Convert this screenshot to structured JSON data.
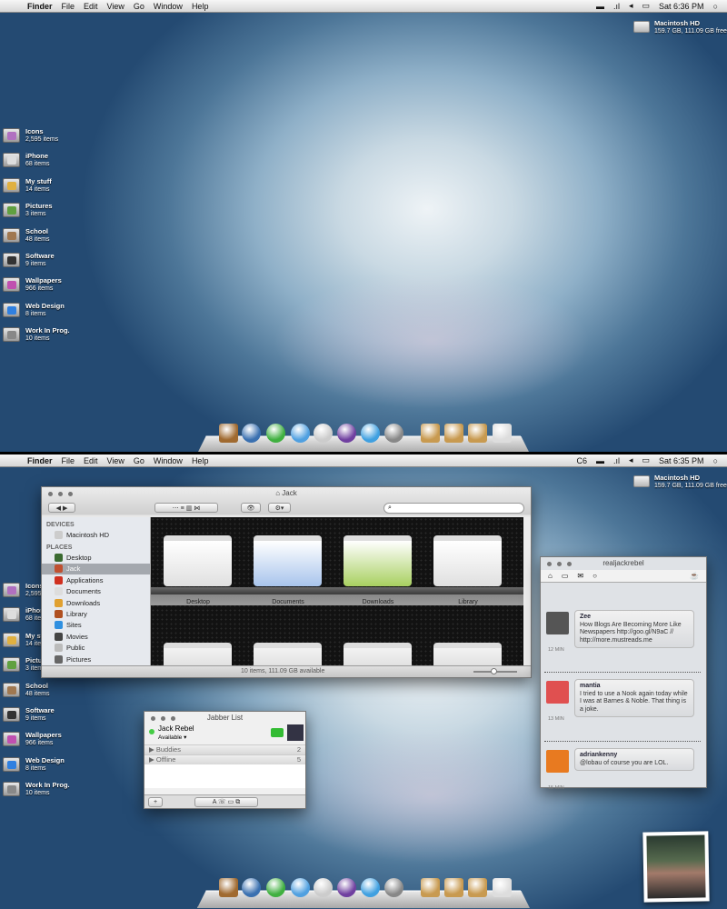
{
  "screens": [
    {
      "menu": {
        "app": "Finder",
        "items": [
          "File",
          "Edit",
          "View",
          "Go",
          "Window",
          "Help"
        ],
        "status": {
          "extra": "",
          "clock": "Sat 6:36 PM"
        }
      }
    },
    {
      "menu": {
        "app": "Finder",
        "items": [
          "File",
          "Edit",
          "View",
          "Go",
          "Window",
          "Help"
        ],
        "status": {
          "extra": "C6",
          "clock": "Sat 6:35 PM"
        }
      }
    }
  ],
  "drive": {
    "name": "Macintosh HD",
    "info": "159.7 GB, 111.09 GB free"
  },
  "desktop_icons": [
    {
      "name": "Icons",
      "count": "2,595 items",
      "color": "#b070c0"
    },
    {
      "name": "iPhone",
      "count": "68 items",
      "color": "#dddddd"
    },
    {
      "name": "My stuff",
      "count": "14 items",
      "color": "#e0b040"
    },
    {
      "name": "Pictures",
      "count": "3 items",
      "color": "#60a040"
    },
    {
      "name": "School",
      "count": "48 items",
      "color": "#a07850"
    },
    {
      "name": "Software",
      "count": "9 items",
      "color": "#333333"
    },
    {
      "name": "Wallpapers",
      "count": "966 items",
      "color": "#c050b0"
    },
    {
      "name": "Web Design",
      "count": "8 items",
      "color": "#3080e0"
    },
    {
      "name": "Work In Prog.",
      "count": "10 items",
      "color": "#888888"
    }
  ],
  "dock": [
    {
      "icon": "bookshelf-icon",
      "color": "#a06a30"
    },
    {
      "icon": "safari-icon",
      "color": "#3a70b0"
    },
    {
      "icon": "facetime-icon",
      "color": "#40b040"
    },
    {
      "icon": "button-app-icon",
      "color": "#50a0e0"
    },
    {
      "icon": "itunes-icon",
      "color": "#cccccc"
    },
    {
      "icon": "downloads-icon",
      "color": "#7040a0"
    },
    {
      "icon": "ichat-icon",
      "color": "#40a0e0"
    },
    {
      "icon": "system-preferences-icon",
      "color": "#888888"
    },
    {
      "icon": "applications-stack-icon",
      "color": "#c89a50"
    },
    {
      "icon": "documents-stack-icon",
      "color": "#c89a50"
    },
    {
      "icon": "downloads-stack-icon",
      "color": "#c89a50"
    },
    {
      "icon": "trash-icon",
      "color": "#dddddd"
    }
  ],
  "finder": {
    "title": "Jack",
    "search_placeholder": "",
    "sidebar": {
      "devices_label": "DEVICES",
      "devices": [
        "Macintosh HD"
      ],
      "places_label": "PLACES",
      "places": [
        {
          "label": "Desktop",
          "color": "#3a6a30"
        },
        {
          "label": "Jack",
          "color": "#c05030",
          "selected": true
        },
        {
          "label": "Applications",
          "color": "#d03020"
        },
        {
          "label": "Documents",
          "color": "#dddddd"
        },
        {
          "label": "Downloads",
          "color": "#e0a030"
        },
        {
          "label": "Library",
          "color": "#b05020"
        },
        {
          "label": "Sites",
          "color": "#3090e0"
        },
        {
          "label": "Movies",
          "color": "#444444"
        },
        {
          "label": "Public",
          "color": "#bbbbbb"
        },
        {
          "label": "Pictures",
          "color": "#666666"
        }
      ]
    },
    "items": [
      {
        "label": "Desktop",
        "color": "#e0e0e0"
      },
      {
        "label": "Documents",
        "color": "#a8c4ec"
      },
      {
        "label": "Downloads",
        "color": "#a8d060"
      },
      {
        "label": "Library",
        "color": "#e0e0e0"
      }
    ],
    "status": "10 items, 111.09 GB available",
    "icon_size_fraction": 0.45
  },
  "twitter": {
    "title": "realjackrebel",
    "tweets": [
      {
        "user": "Zee",
        "text": "How Blogs Are Becoming More Like Newspapers http://goo.gl/N9aC // http://more.mustreads.me",
        "time": "12 MIN",
        "color": "#555555"
      },
      {
        "user": "mantia",
        "text": "I tried to use a Nook again today while I was at Barnes & Noble. That thing is a joke.",
        "time": "13 MIN",
        "color": "#e05050"
      },
      {
        "user": "adriankenny",
        "text": "@lobau of course you are LOL.",
        "time": "15 MIN",
        "color": "#e87a20"
      }
    ]
  },
  "jabber": {
    "title": "Jabber List",
    "user": "Jack Rebel",
    "status": "Available",
    "groups": [
      {
        "name": "Buddies",
        "count": "2"
      },
      {
        "name": "Offline",
        "count": "5"
      }
    ]
  },
  "colors": {
    "accent": "#3875d7",
    "menubar": "#e6e6e6"
  }
}
